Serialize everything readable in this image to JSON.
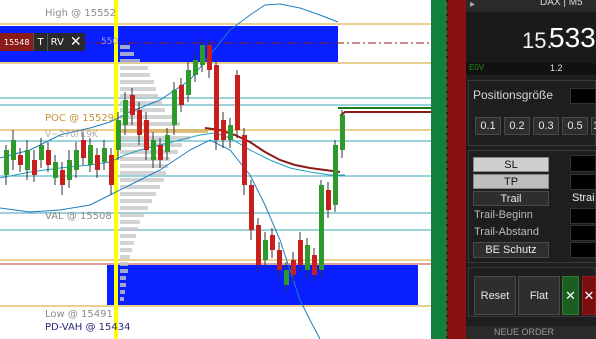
{
  "chart": {
    "labels": {
      "high": "High @ 15552",
      "poc": "POC @ 15529",
      "vwap": "V~270/T.9K",
      "val": "VAL @ 15508",
      "low": "Low @ 15491",
      "pd_vah": "PD-VAH @ 15434",
      "partial_order": "550"
    },
    "order": {
      "price": "15548",
      "btn_t": "T",
      "btn_rv": "RV",
      "close_icon": "close-icon"
    },
    "colors": {
      "up_candle": "#2e9a2e",
      "down_candle": "#c81e1e",
      "volume_zone": "#0a1fff",
      "session_line": "#ffff00",
      "band": "#1f7fbf",
      "poc_line": "#d4a020",
      "ma_line": "#8b1a1a"
    }
  },
  "panel": {
    "header": "DAX | M5",
    "price_major": "15.",
    "price_minor": "533",
    "small_left": "E0V",
    "small_right": "1.2",
    "position_size_label": "Positionsgröße",
    "size_buttons": [
      "0.1",
      "0.2",
      "0.3",
      "0.5",
      "1"
    ],
    "sl": "SL",
    "tp": "TP",
    "trail": "Trail",
    "trail_right": "Strai",
    "trail_begin": "Trail-Beginn",
    "trail_distance": "Trail-Abstand",
    "be_protection": "BE Schutz",
    "reset": "Reset",
    "flat": "Flat",
    "bottom_text": "NEUE ORDER",
    "colors": {
      "green_stripe": "#15803d",
      "red_stripe": "#8b1010",
      "buy": "#1b5e20",
      "sell": "#7a0f0f"
    }
  }
}
